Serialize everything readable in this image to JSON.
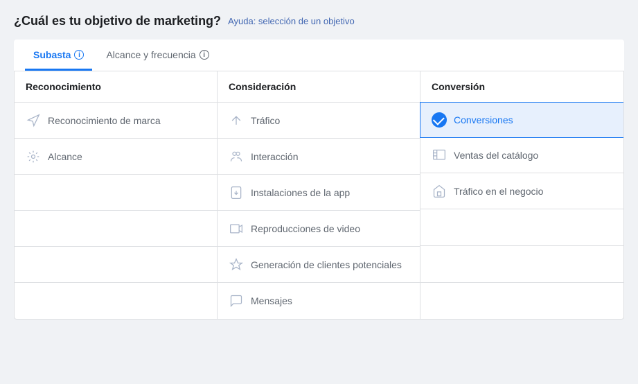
{
  "page": {
    "title": "¿Cuál es tu objetivo de marketing?",
    "help_link": "Ayuda: selección de un objetivo"
  },
  "tabs": [
    {
      "id": "subasta",
      "label": "Subasta",
      "info": "i",
      "active": true
    },
    {
      "id": "alcance",
      "label": "Alcance y frecuencia",
      "info": "i",
      "active": false
    }
  ],
  "columns": [
    {
      "id": "reconocimiento",
      "header": "Reconocimiento",
      "items": [
        {
          "id": "reconocimiento-marca",
          "label": "Reconocimiento de marca",
          "icon": "brand-awareness-icon",
          "selected": false
        },
        {
          "id": "alcance",
          "label": "Alcance",
          "icon": "reach-icon",
          "selected": false
        }
      ]
    },
    {
      "id": "consideracion",
      "header": "Consideración",
      "items": [
        {
          "id": "trafico",
          "label": "Tráfico",
          "icon": "traffic-icon",
          "selected": false
        },
        {
          "id": "interaccion",
          "label": "Interacción",
          "icon": "engagement-icon",
          "selected": false
        },
        {
          "id": "instalaciones-app",
          "label": "Instalaciones de la app",
          "icon": "app-installs-icon",
          "selected": false
        },
        {
          "id": "reproducciones-video",
          "label": "Reproducciones de video",
          "icon": "video-views-icon",
          "selected": false
        },
        {
          "id": "generacion-clientes",
          "label": "Generación de clientes potenciales",
          "icon": "lead-gen-icon",
          "selected": false
        },
        {
          "id": "mensajes",
          "label": "Mensajes",
          "icon": "messages-icon",
          "selected": false
        }
      ]
    },
    {
      "id": "conversion",
      "header": "Conversión",
      "items": [
        {
          "id": "conversiones",
          "label": "Conversiones",
          "icon": "conversions-icon",
          "selected": true
        },
        {
          "id": "ventas-catalogo",
          "label": "Ventas del catálogo",
          "icon": "catalog-sales-icon",
          "selected": false
        },
        {
          "id": "trafico-negocio",
          "label": "Tráfico en el negocio",
          "icon": "store-traffic-icon",
          "selected": false
        }
      ]
    }
  ]
}
